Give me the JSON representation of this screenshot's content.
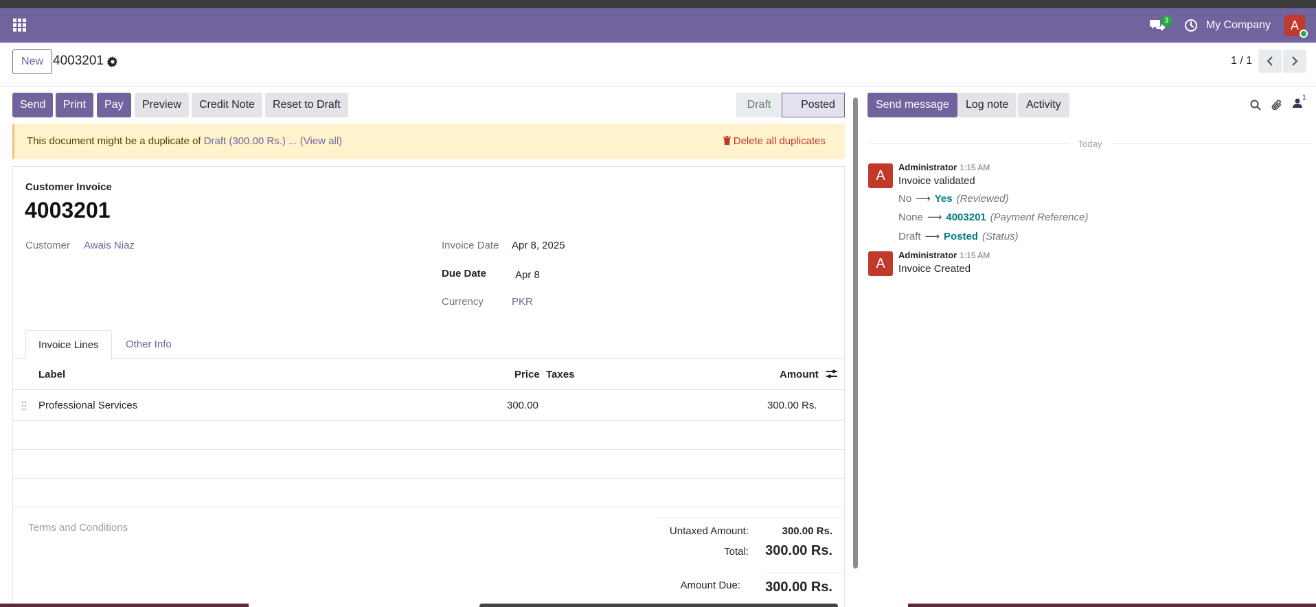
{
  "navbar": {
    "messages_count": "3",
    "company": "My Company",
    "user_initial": "A"
  },
  "control_panel": {
    "new_label": "New",
    "record_title": "4003201",
    "pager": "1 / 1"
  },
  "actions": {
    "send": "Send",
    "print": "Print",
    "pay": "Pay",
    "preview": "Preview",
    "credit_note": "Credit Note",
    "reset_to_draft": "Reset to Draft"
  },
  "stages": {
    "draft": "Draft",
    "posted": "Posted"
  },
  "duplicate_alert": {
    "text": "This document might be a duplicate of",
    "link": "Draft (300.00 Rs.)",
    "ellipsis": "...",
    "view_all": "(View all)",
    "delete_all": "Delete all duplicates"
  },
  "invoice": {
    "type": "Customer Invoice",
    "number": "4003201",
    "customer_label": "Customer",
    "customer": "Awais Niaz",
    "invoice_date_label": "Invoice Date",
    "invoice_date": "Apr 8, 2025",
    "due_date_label": "Due Date",
    "due_date": "Apr 8",
    "currency_label": "Currency",
    "currency": "PKR"
  },
  "tabs": {
    "invoice_lines": "Invoice Lines",
    "other_info": "Other Info"
  },
  "lines": {
    "headers": {
      "label": "Label",
      "price": "Price",
      "taxes": "Taxes",
      "amount": "Amount"
    },
    "rows": [
      {
        "label": "Professional Services",
        "price": "300.00",
        "taxes": "",
        "amount": "300.00 Rs."
      }
    ]
  },
  "footer": {
    "terms_placeholder": "Terms and Conditions",
    "untaxed_label": "Untaxed Amount:",
    "untaxed_value": "300.00 Rs.",
    "total_label": "Total:",
    "total_value": "300.00 Rs.",
    "amount_due_label": "Amount Due:",
    "amount_due_value": "300.00 Rs."
  },
  "chatter": {
    "send_message": "Send message",
    "log_note": "Log note",
    "activity": "Activity",
    "followers_count": "1",
    "today": "Today",
    "messages": [
      {
        "initial": "A",
        "author": "Administrator",
        "time": "1:15 AM",
        "body": "Invoice validated",
        "tracking": [
          {
            "old": "No",
            "new": "Yes",
            "field": "(Reviewed)"
          },
          {
            "old": "None",
            "new": "4003201",
            "field": "(Payment Reference)"
          },
          {
            "old": "Draft",
            "new": "Posted",
            "field": "(Status)"
          }
        ]
      },
      {
        "initial": "A",
        "author": "Administrator",
        "time": "1:15 AM",
        "body": "Invoice Created",
        "tracking": []
      }
    ]
  },
  "colors": {
    "brand": "#71639e",
    "alert_bg": "#fff3cd",
    "danger": "#c0392b",
    "tracking_new": "#017e84"
  }
}
